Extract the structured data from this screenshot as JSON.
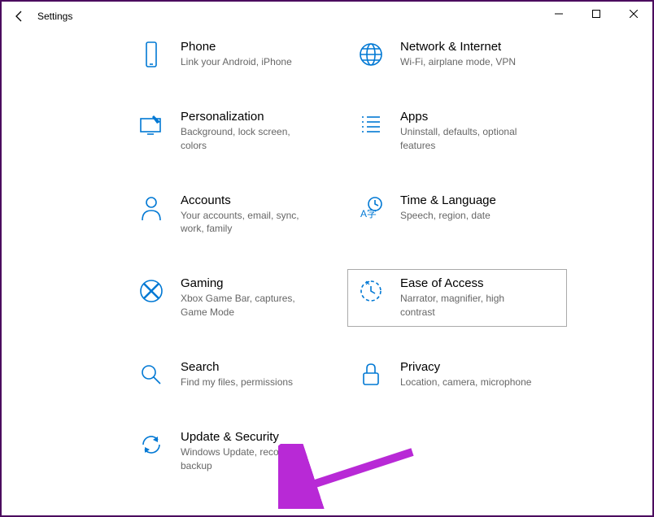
{
  "window": {
    "title": "Settings"
  },
  "tiles": [
    {
      "id": "phone",
      "title": "Phone",
      "sub": "Link your Android, iPhone"
    },
    {
      "id": "network",
      "title": "Network & Internet",
      "sub": "Wi-Fi, airplane mode, VPN"
    },
    {
      "id": "personalization",
      "title": "Personalization",
      "sub": "Background, lock screen, colors"
    },
    {
      "id": "apps",
      "title": "Apps",
      "sub": "Uninstall, defaults, optional features"
    },
    {
      "id": "accounts",
      "title": "Accounts",
      "sub": "Your accounts, email, sync, work, family"
    },
    {
      "id": "time",
      "title": "Time & Language",
      "sub": "Speech, region, date"
    },
    {
      "id": "gaming",
      "title": "Gaming",
      "sub": "Xbox Game Bar, captures, Game Mode"
    },
    {
      "id": "ease",
      "title": "Ease of Access",
      "sub": "Narrator, magnifier, high contrast"
    },
    {
      "id": "search",
      "title": "Search",
      "sub": "Find my files, permissions"
    },
    {
      "id": "privacy",
      "title": "Privacy",
      "sub": "Location, camera, microphone"
    },
    {
      "id": "update",
      "title": "Update & Security",
      "sub": "Windows Update, recovery, backup"
    }
  ],
  "highlighted_tile": "ease",
  "annotation_arrow_points_to": "update"
}
